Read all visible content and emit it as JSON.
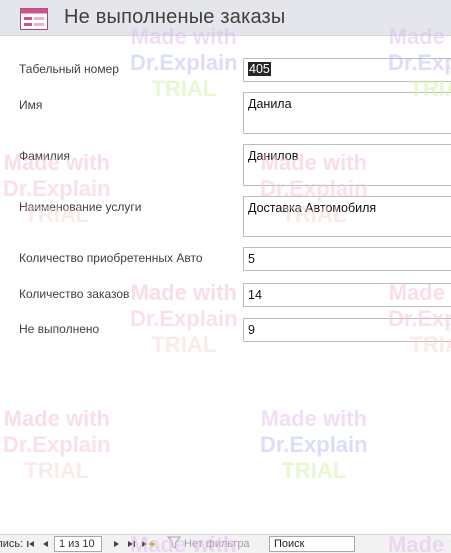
{
  "header": {
    "title": "Не выполненые заказы",
    "icon": "form-icon"
  },
  "fields": [
    {
      "label": "Табельный номер",
      "value": "405",
      "selected": true
    },
    {
      "label": "Имя",
      "value": "Данила"
    },
    {
      "label": "Фамилия",
      "value": "Данилов"
    },
    {
      "label": "Наименование услуги",
      "value": "Доставка Автомобиля"
    },
    {
      "label": "Количество приобретенных Авто",
      "value": "5"
    },
    {
      "label": "Количество заказов",
      "value": "14"
    },
    {
      "label": "Не выполнено",
      "value": "9"
    }
  ],
  "watermark": {
    "line1": "Made with",
    "line2": "Dr.Explain",
    "line3": "TRIAL"
  },
  "navbar": {
    "label": "Запись:",
    "record_position": "1 из 10",
    "filter_label": "Нет фильтра",
    "search_placeholder": "Поиск",
    "icons": [
      "first-record",
      "previous-record",
      "next-record",
      "last-record",
      "new-record",
      "filter-icon"
    ]
  },
  "colors": {
    "header_bg": "#e4e6ec",
    "field_border": "#b9bcc2",
    "selection": "#262626"
  }
}
